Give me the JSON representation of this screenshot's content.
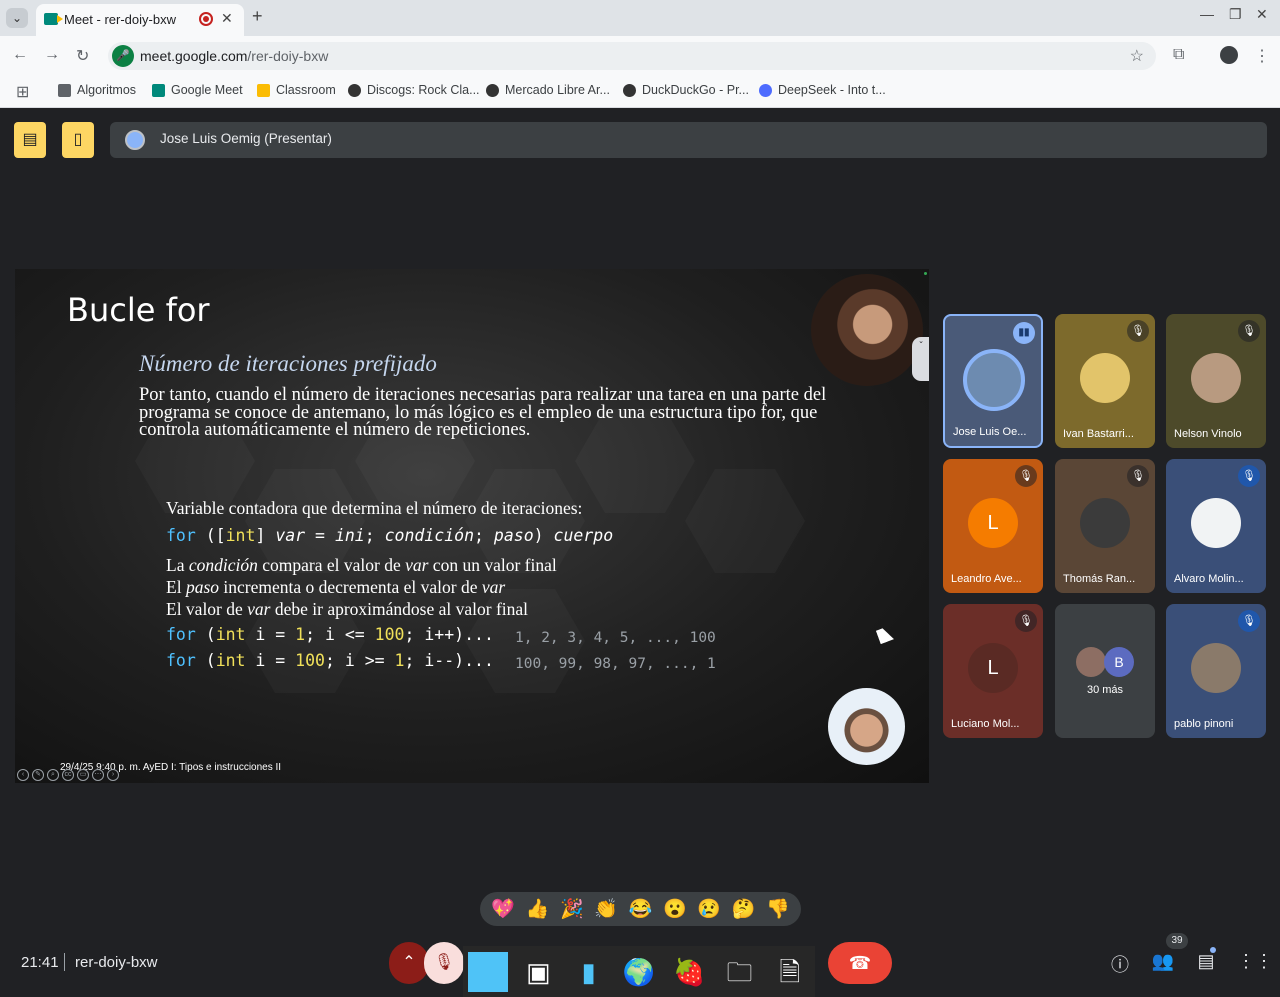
{
  "browser": {
    "tab_title": "Meet - rer-doiy-bxw",
    "url_host": "meet.google.com",
    "url_path": "/rer-doiy-bxw",
    "bookmarks": [
      {
        "label": "Algoritmos",
        "color": "#5f6368"
      },
      {
        "label": "Google Meet",
        "color": "#00897b"
      },
      {
        "label": "Classroom",
        "color": "#fbbc04"
      },
      {
        "label": "Discogs: Rock Cla...",
        "color": "#333333"
      },
      {
        "label": "Mercado Libre Ar...",
        "color": "#333333"
      },
      {
        "label": "DuckDuckGo - Pr...",
        "color": "#333333"
      },
      {
        "label": "DeepSeek - Into t...",
        "color": "#4d6bfe"
      }
    ]
  },
  "meet": {
    "presenter_label": "Jose Luis Oemig (Presentar)",
    "slide": {
      "title": "Bucle for",
      "subtitle": "Número de iteraciones prefijado",
      "paragraph": "Por tanto, cuando el número de iteraciones necesarias para realizar una tarea en una parte del programa se conoce de antemano, lo más lógico es el empleo de una estructura tipo for, que controla automáticamente el número de repeticiones.",
      "line_counter": "Variable contadora que determina el número de iteraciones:",
      "syntax": {
        "kw": "for",
        "open": " ([",
        "type": "int",
        "rest1": "] ",
        "var": "var",
        "eq": " = ",
        "ini": "ini",
        "semi1": "; ",
        "cond": "condición",
        "semi2": "; ",
        "paso": "paso",
        "close": ") ",
        "body": "cuerpo"
      },
      "line_cond": {
        "a": "La ",
        "b": "condición",
        "c": " compara el valor de ",
        "d": "var",
        "e": " con un valor final"
      },
      "line_paso": {
        "a": "El ",
        "b": "paso",
        "c": " incrementa o decrementa el valor de ",
        "d": "var"
      },
      "line_valor": {
        "a": "El valor de ",
        "b": "var",
        "c": " debe ir aproximándose al valor final"
      },
      "code1": {
        "kw": "for",
        "p1": " (",
        "type": "int",
        "p2": " i = ",
        "n1": "1",
        "p3": "; i <= ",
        "n2": "100",
        "p4": "; i++)..."
      },
      "code2": {
        "kw": "for",
        "p1": " (",
        "type": "int",
        "p2": " i = ",
        "n1": "100",
        "p3": "; i >= ",
        "n2": "1",
        "p4": "; i--)..."
      },
      "seq1": "1, 2, 3, 4, 5, ..., 100",
      "seq2": "100, 99, 98, 97, ..., 1",
      "footer": "29/4/25 9:40 p. m.",
      "footer2": "AyED I: Tipos e instrucciones II"
    },
    "participants": [
      {
        "name": "Jose Luis Oe...",
        "state": "speaking",
        "bg": "#4a5a78"
      },
      {
        "name": "Ivan Bastarri...",
        "state": "muted",
        "bg": "#7d6a2c"
      },
      {
        "name": "Nelson Vinolo",
        "state": "muted",
        "bg": "#4d4a2a"
      },
      {
        "name": "Leandro Ave...",
        "state": "muted",
        "bg": "#c25a12",
        "initial": "L"
      },
      {
        "name": "Thomás Ran...",
        "state": "muted",
        "bg": "#5a4636"
      },
      {
        "name": "Alvaro Molin...",
        "state": "muted-blue",
        "bg": "#3a4f78"
      },
      {
        "name": "Luciano Mol...",
        "state": "muted",
        "bg": "#6b2e28",
        "initial": "L"
      },
      {
        "name": "30 más",
        "state": "more",
        "bg": "#3c4043",
        "initial": "B"
      },
      {
        "name": "pablo pinoni",
        "state": "muted-blue",
        "bg": "#3a4f78"
      }
    ],
    "clock": "21:41",
    "meeting_code": "rer-doiy-bxw",
    "people_count": "39",
    "reactions": [
      "💖",
      "👍",
      "🎉",
      "👏",
      "😂",
      "😮",
      "😢",
      "🤔",
      "👎"
    ],
    "dock_icons": [
      "window",
      "terminal",
      "files",
      "browser",
      "strawberry",
      "folder",
      "document"
    ]
  }
}
